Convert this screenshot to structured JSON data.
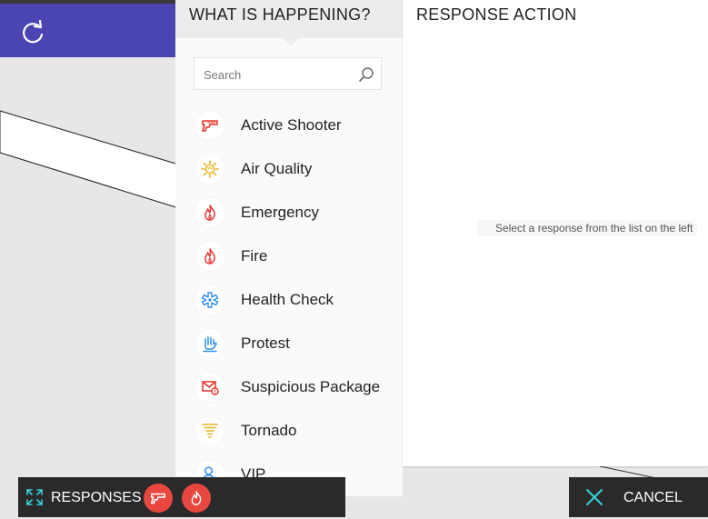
{
  "refresh": {
    "icon": "refresh-icon"
  },
  "left_panel": {
    "title": "WHAT IS HAPPENING?",
    "search": {
      "placeholder": "Search",
      "value": ""
    },
    "items": [
      {
        "label": "Active Shooter",
        "icon": "gun-icon",
        "color": "#e8322a"
      },
      {
        "label": "Air Quality",
        "icon": "sun-icon",
        "color": "#e9b21f"
      },
      {
        "label": "Emergency",
        "icon": "flame-icon",
        "color": "#e8322a"
      },
      {
        "label": "Fire",
        "icon": "flame-icon",
        "color": "#e8322a"
      },
      {
        "label": "Health Check",
        "icon": "medical-star-icon",
        "color": "#2f8fe5"
      },
      {
        "label": "Protest",
        "icon": "raised-hand-icon",
        "color": "#2f8fe5"
      },
      {
        "label": "Suspicious Package",
        "icon": "envelope-alert-icon",
        "color": "#e8322a"
      },
      {
        "label": "Tornado",
        "icon": "tornado-icon",
        "color": "#e9b21f"
      },
      {
        "label": "VIP",
        "icon": "person-star-icon",
        "color": "#2f8fe5"
      }
    ]
  },
  "right_panel": {
    "title": "RESPONSE ACTION",
    "placeholder": "Select a response from the list on the left"
  },
  "bottom": {
    "responses_label": "RESPONSES",
    "cancel_label": "CANCEL"
  },
  "colors": {
    "header_purple": "#4b45b3",
    "accent_red": "#e8473f",
    "accent_teal": "#35d0d8",
    "dark_bar": "#2a2a2a"
  }
}
